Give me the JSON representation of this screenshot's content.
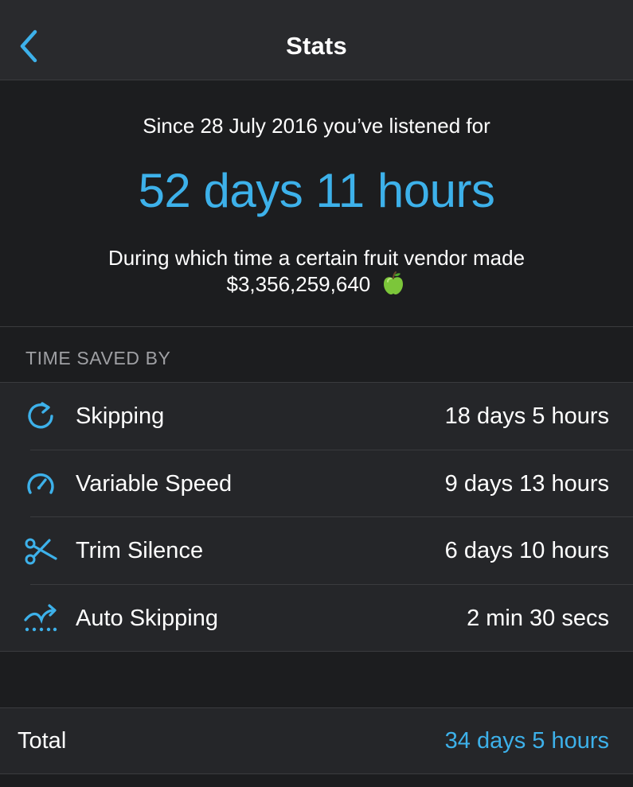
{
  "header": {
    "title": "Stats",
    "back_icon": "chevron-left-icon"
  },
  "summary": {
    "since_text": "Since 28 July 2016 you’ve listened for",
    "total_listened": "52 days 11 hours",
    "vendor_text": "During which time a certain fruit vendor made",
    "vendor_amount": "$3,356,259,640",
    "vendor_icon": "green-apple-icon"
  },
  "time_saved": {
    "header": "TIME SAVED BY",
    "items": [
      {
        "label": "Skipping",
        "value": "18 days 5 hours",
        "icon": "skip-forward-icon"
      },
      {
        "label": "Variable Speed",
        "value": "9 days 13 hours",
        "icon": "speedometer-icon"
      },
      {
        "label": "Trim Silence",
        "value": "6 days 10 hours",
        "icon": "scissors-icon"
      },
      {
        "label": "Auto Skipping",
        "value": "2 min 30 secs",
        "icon": "auto-skip-icon"
      }
    ]
  },
  "total": {
    "label": "Total",
    "value": "34 days 5 hours"
  },
  "colors": {
    "accent": "#3db1ea",
    "background": "#1c1d1f",
    "navbar": "#292a2d",
    "row_background": "#252629",
    "section_text": "#9fa0a4"
  }
}
